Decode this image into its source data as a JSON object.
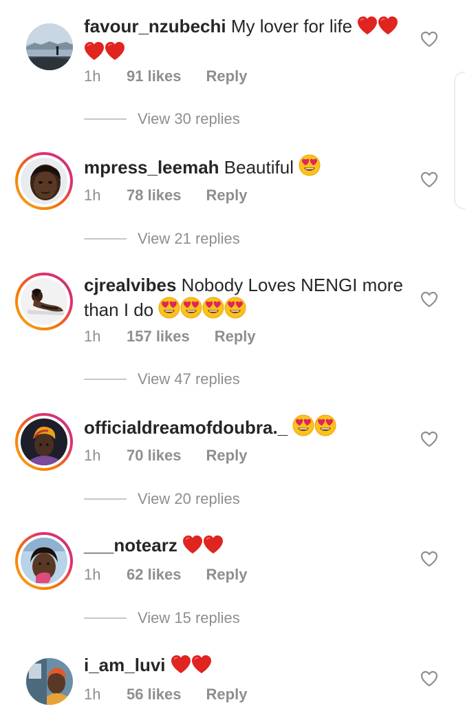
{
  "comments": [
    {
      "username": "favour_nzubechi",
      "text": "My lover for life",
      "emojis": [
        "red-heart",
        "red-heart",
        "red-heart",
        "red-heart"
      ],
      "time": "1h",
      "likes": "91 likes",
      "reply": "Reply",
      "view_replies": "View 30 replies",
      "story_ring": false
    },
    {
      "username": "mpress_leemah",
      "text": "Beautiful",
      "emojis": [
        "heart-eyes"
      ],
      "time": "1h",
      "likes": "78 likes",
      "reply": "Reply",
      "view_replies": "View 21 replies",
      "story_ring": true
    },
    {
      "username": "cjrealvibes",
      "text": "Nobody Loves NENGI more than I do",
      "emojis": [
        "heart-eyes",
        "heart-eyes",
        "heart-eyes",
        "heart-eyes"
      ],
      "time": "1h",
      "likes": "157 likes",
      "reply": "Reply",
      "view_replies": "View 47 replies",
      "story_ring": true
    },
    {
      "username": "officialdreamofdoubra._",
      "text": "",
      "emojis": [
        "heart-eyes",
        "heart-eyes"
      ],
      "time": "1h",
      "likes": "70 likes",
      "reply": "Reply",
      "view_replies": "View 20 replies",
      "story_ring": true
    },
    {
      "username": "___notearz",
      "text": "",
      "emojis": [
        "red-heart",
        "red-heart"
      ],
      "time": "1h",
      "likes": "62 likes",
      "reply": "Reply",
      "view_replies": "View 15 replies",
      "story_ring": true
    },
    {
      "username": "i_am_luvi",
      "text": "",
      "emojis": [
        "red-heart",
        "red-heart"
      ],
      "time": "1h",
      "likes": "56 likes",
      "reply": "Reply",
      "story_ring": false
    }
  ],
  "colors": {
    "text": "#262626",
    "secondary": "#8e8e8e",
    "heart_red": "#e0241f",
    "emoji_yellow": "#fcc21b"
  }
}
